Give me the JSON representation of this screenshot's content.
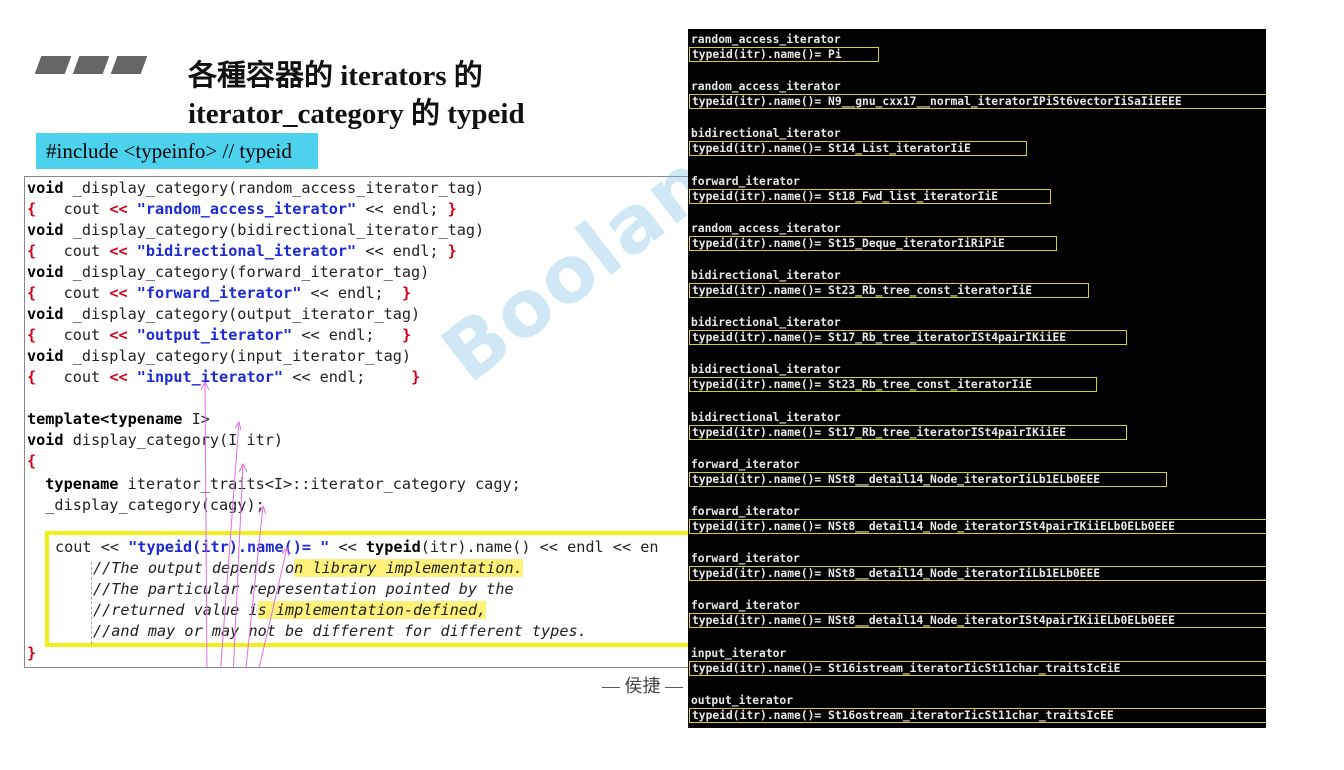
{
  "slide": {
    "title_line1": "各種容器的 iterators 的",
    "title_line2": "iterator_category 的 typeid",
    "include": "#include <typeinfo>  // typeid",
    "footer": "— 侯捷 —",
    "watermark": "Boolan 博"
  },
  "code": {
    "l1a": "void",
    "l1b": " _display_category(random_access_iterator_tag)",
    "l2a": "{",
    "l2b": "   cout ",
    "l2c": "<<",
    "l2d": " \"random_access_iterator\"",
    "l2e": " << endl; ",
    "l2f": "}",
    "l3a": "void",
    "l3b": " _display_category(bidirectional_iterator_tag)",
    "l4a": "{",
    "l4b": "   cout ",
    "l4c": "<<",
    "l4d": " \"bidirectional_iterator\"",
    "l4e": " << endl; ",
    "l4f": "}",
    "l5a": "void",
    "l5b": " _display_category(forward_iterator_tag)",
    "l6a": "{",
    "l6b": "   cout ",
    "l6c": "<<",
    "l6d": " \"forward_iterator\"",
    "l6e": " << endl;  ",
    "l6f": "}",
    "l7a": "void",
    "l7b": " _display_category(output_iterator_tag)",
    "l8a": "{",
    "l8b": "   cout ",
    "l8c": "<<",
    "l8d": " \"output_iterator\"",
    "l8e": " << endl;   ",
    "l8f": "}",
    "l9a": "void",
    "l9b": " _display_category(input_iterator_tag)",
    "l10a": "{",
    "l10b": "   cout ",
    "l10c": "<<",
    "l10d": " \"input_iterator\"",
    "l10e": " << endl;     ",
    "l10f": "}",
    "l11a": "template",
    "l11b": "<typename",
    "l11c": " I>",
    "l12a": "void",
    "l12b": " display_category(I itr)",
    "l13a": "{",
    "l14a": "  typename",
    "l14b": " iterator_traits<I>::iterator_category cagy;",
    "l15a": "  _display_category(cagy);",
    "l16a": "cout << ",
    "l16b": "\"typeid(itr).name()= \"",
    "l16c": " << ",
    "l16d": "typeid",
    "l16e": "(itr).name() << endl << en",
    "c1a": "//The output depends o",
    "c1b": "n library implementation.",
    "c2a": "//The particular representation pointed by the",
    "c3a": "//returned value i",
    "c3b": "s implementation-defined,",
    "c4a": "//and may or may not be different for different types.",
    "l17a": "}"
  },
  "terminal": [
    {
      "cat": "random_access_iterator",
      "val": "typeid(itr).name()= Pi"
    },
    {
      "cat": "random_access_iterator",
      "val": "typeid(itr).name()= N9__gnu_cxx17__normal_iteratorIPiSt6vectorIiSaIiEEEE"
    },
    {
      "cat": "bidirectional_iterator",
      "val": "typeid(itr).name()= St14_List_iteratorIiE"
    },
    {
      "cat": "forward_iterator",
      "val": "typeid(itr).name()= St18_Fwd_list_iteratorIiE"
    },
    {
      "cat": "random_access_iterator",
      "val": "typeid(itr).name()= St15_Deque_iteratorIiRiPiE"
    },
    {
      "cat": "bidirectional_iterator",
      "val": "typeid(itr).name()= St23_Rb_tree_const_iteratorIiE"
    },
    {
      "cat": "bidirectional_iterator",
      "val": "typeid(itr).name()= St17_Rb_tree_iteratorISt4pairIKiiEE"
    },
    {
      "cat": "bidirectional_iterator",
      "val": "typeid(itr).name()= St23_Rb_tree_const_iteratorIiE"
    },
    {
      "cat": "bidirectional_iterator",
      "val": "typeid(itr).name()= St17_Rb_tree_iteratorISt4pairIKiiEE"
    },
    {
      "cat": "forward_iterator",
      "val": "typeid(itr).name()= NSt8__detail14_Node_iteratorIiLb1ELb0EEE"
    },
    {
      "cat": "forward_iterator",
      "val": "typeid(itr).name()= NSt8__detail14_Node_iteratorISt4pairIKiiELb0ELb0EEE"
    },
    {
      "cat": "forward_iterator",
      "val": "typeid(itr).name()= NSt8__detail14_Node_iteratorIiLb1ELb0EEE"
    },
    {
      "cat": "forward_iterator",
      "val": "typeid(itr).name()= NSt8__detail14_Node_iteratorISt4pairIKiiELb0ELb0EEE"
    },
    {
      "cat": "input_iterator",
      "val": "typeid(itr).name()= St16istream_iteratorIicSt11char_traitsIcEiE"
    },
    {
      "cat": "output_iterator",
      "val": "typeid(itr).name()= St16ostream_iteratorIicSt11char_traitsIcEE"
    }
  ],
  "colors": {
    "include_bg": "#4dd2ee",
    "highlight_box": "#f2ee1a",
    "terminal_bg": "#000000"
  }
}
